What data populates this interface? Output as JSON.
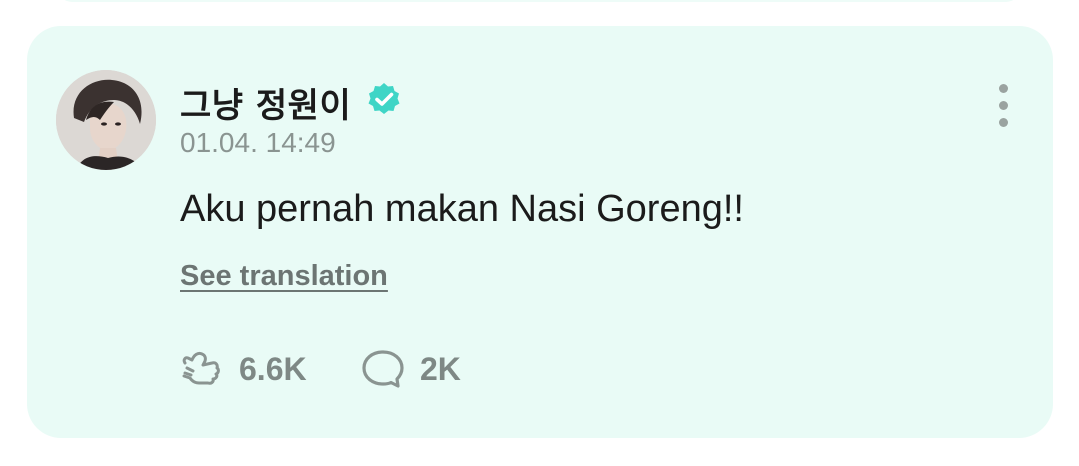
{
  "post": {
    "author_name": "그냥 정원이",
    "verified": true,
    "timestamp": "01.04. 14:49",
    "body": "Aku pernah makan Nasi Goreng!!",
    "translate_label": "See translation",
    "like_count": "6.6K",
    "comment_count": "2K"
  },
  "icons": {
    "verified": "verified-check-icon",
    "more": "more-vertical-icon",
    "like": "like-hand-icon",
    "comment": "comment-bubble-icon"
  },
  "colors": {
    "card_background": "#e9fbf6",
    "verified_badge": "#3fd5c6",
    "text_primary": "#1b1b1b",
    "text_secondary": "#8a9491"
  }
}
